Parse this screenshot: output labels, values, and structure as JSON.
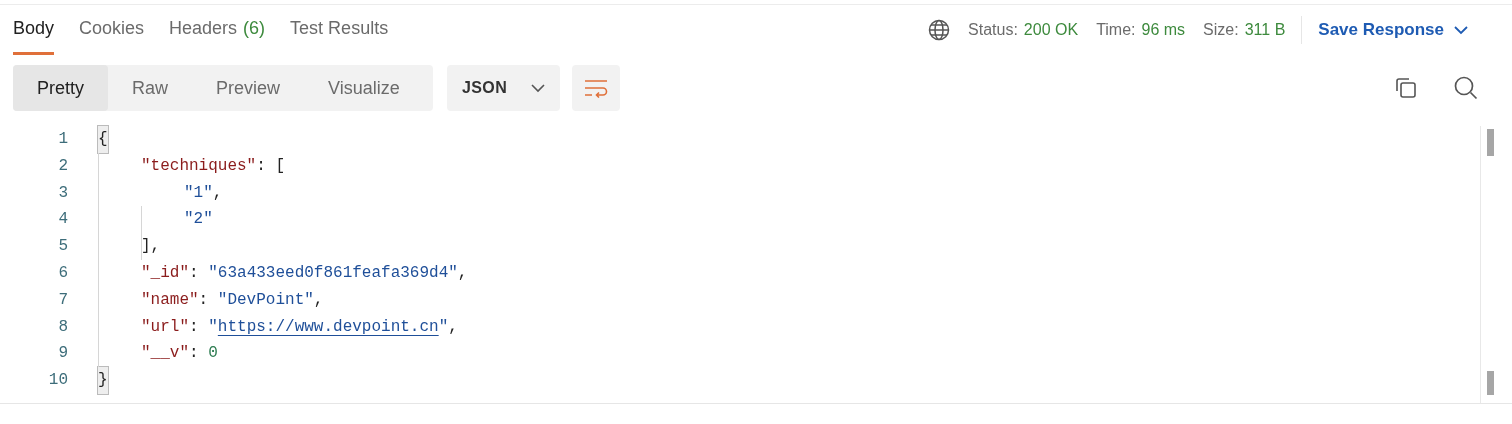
{
  "tabs": [
    {
      "label": "Body",
      "selected": true
    },
    {
      "label": "Cookies",
      "selected": false
    },
    {
      "label": "Headers",
      "count": "(6)",
      "selected": false
    },
    {
      "label": "Test Results",
      "selected": false
    }
  ],
  "status": [
    {
      "label": "Status:",
      "value": "200 OK"
    },
    {
      "label": "Time:",
      "value": "96 ms"
    },
    {
      "label": "Size:",
      "value": "311 B"
    }
  ],
  "save_button": {
    "label": "Save Response"
  },
  "view_modes": [
    {
      "label": "Pretty",
      "selected": true
    },
    {
      "label": "Raw",
      "selected": false
    },
    {
      "label": "Preview",
      "selected": false
    },
    {
      "label": "Visualize",
      "selected": false
    }
  ],
  "format_dropdown": {
    "value": "JSON"
  },
  "code_lines": [
    {
      "number": "1",
      "tokens": [
        {
          "kind": "punct",
          "text": "{",
          "highlighted": true
        }
      ],
      "children": [
        {
          "number": "2",
          "tokens": [
            {
              "kind": "key",
              "text": "\"techniques\"",
              "highlighted": false
            },
            {
              "kind": "punct",
              "text": ": [",
              "highlighted": false
            }
          ],
          "children": [
            {
              "number": "3",
              "tokens": [
                {
                  "kind": "string",
                  "text": "\"1\"",
                  "highlighted": false
                },
                {
                  "kind": "punct",
                  "text": ",",
                  "highlighted": false
                }
              ]
            },
            {
              "number": "4",
              "tokens": [
                {
                  "kind": "string",
                  "text": "\"2\"",
                  "highlighted": false
                }
              ]
            }
          ]
        },
        {
          "number": "5",
          "tokens": [
            {
              "kind": "punct",
              "text": "],",
              "highlighted": false
            }
          ]
        },
        {
          "number": "6",
          "tokens": [
            {
              "kind": "key",
              "text": "\"_id\"",
              "highlighted": false
            },
            {
              "kind": "punct",
              "text": ": ",
              "highlighted": false
            },
            {
              "kind": "string",
              "text": "\"63a433eed0f861feafa369d4\"",
              "highlighted": false
            },
            {
              "kind": "punct",
              "text": ",",
              "highlighted": false
            }
          ]
        },
        {
          "number": "7",
          "tokens": [
            {
              "kind": "key",
              "text": "\"name\"",
              "highlighted": false
            },
            {
              "kind": "punct",
              "text": ": ",
              "highlighted": false
            },
            {
              "kind": "string",
              "text": "\"DevPoint\"",
              "highlighted": false
            },
            {
              "kind": "punct",
              "text": ",",
              "highlighted": false
            }
          ]
        },
        {
          "number": "8",
          "tokens": [
            {
              "kind": "key",
              "text": "\"url\"",
              "highlighted": false
            },
            {
              "kind": "punct",
              "text": ": ",
              "highlighted": false
            },
            {
              "kind": "string",
              "text": "\"",
              "highlighted": false
            },
            {
              "kind": "link",
              "text": "https://www.devpoint.cn",
              "highlighted": false
            },
            {
              "kind": "string",
              "text": "\"",
              "highlighted": false
            },
            {
              "kind": "punct",
              "text": ",",
              "highlighted": false
            }
          ]
        },
        {
          "number": "9",
          "tokens": [
            {
              "kind": "key",
              "text": "\"__v\"",
              "highlighted": false
            },
            {
              "kind": "punct",
              "text": ": ",
              "highlighted": false
            },
            {
              "kind": "number",
              "text": "0",
              "highlighted": false
            }
          ]
        }
      ]
    },
    {
      "number": "10",
      "tokens": [
        {
          "kind": "punct",
          "text": "}",
          "highlighted": true
        }
      ]
    }
  ]
}
